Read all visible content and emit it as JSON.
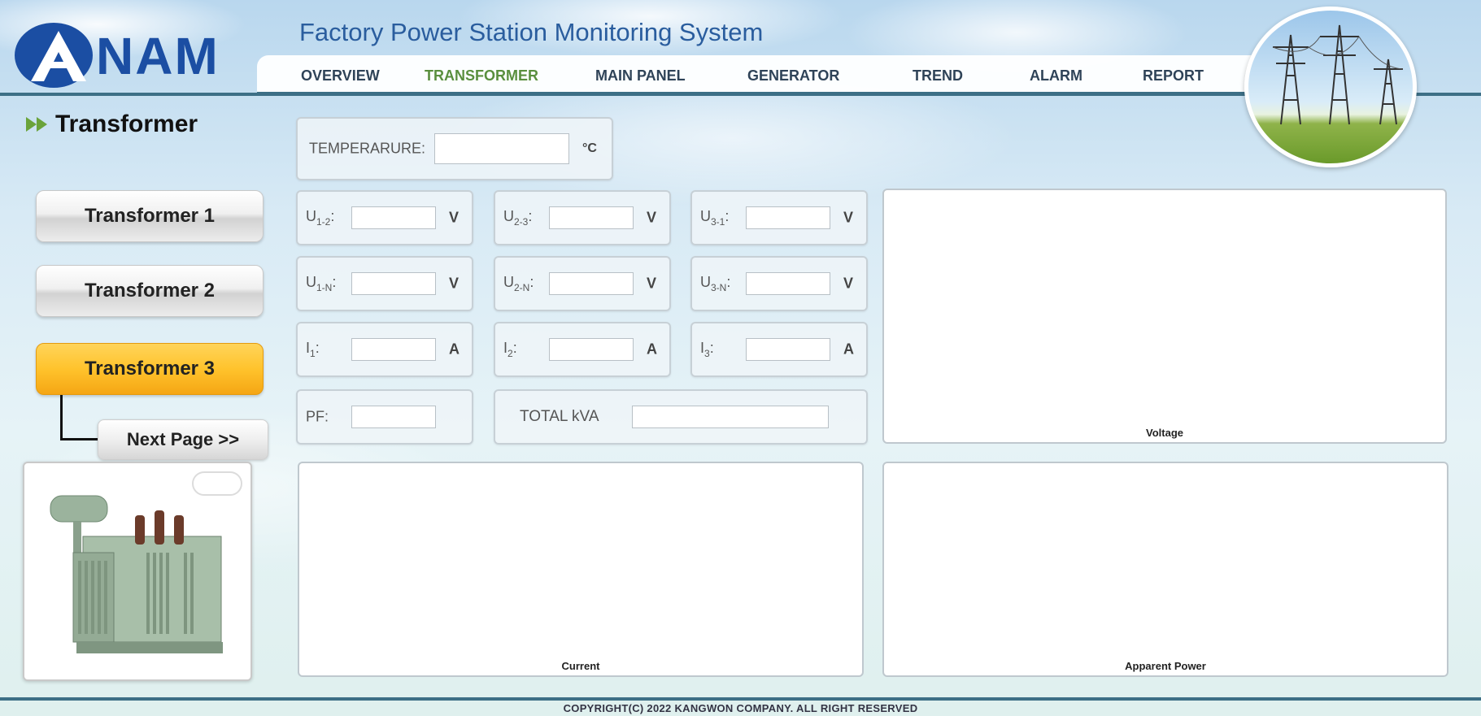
{
  "header": {
    "logo_text": "ANAM",
    "title": "Factory Power Station Monitoring System"
  },
  "nav": {
    "items": [
      {
        "label": "OVERVIEW",
        "active": false
      },
      {
        "label": "TRANSFORMER",
        "active": true
      },
      {
        "label": "MAIN PANEL",
        "active": false
      },
      {
        "label": "GENERATOR",
        "active": false
      },
      {
        "label": "TREND",
        "active": false
      },
      {
        "label": "ALARM",
        "active": false
      },
      {
        "label": "REPORT",
        "active": false
      }
    ]
  },
  "sidebar": {
    "title": "Transformer",
    "buttons": [
      {
        "label": "Transformer 1",
        "active": false
      },
      {
        "label": "Transformer 2",
        "active": false
      },
      {
        "label": "Transformer 3",
        "active": true
      }
    ],
    "next_page": "Next Page >>"
  },
  "readings": {
    "temperature": {
      "label": "TEMPERARURE:",
      "value": "",
      "unit": "°C"
    },
    "u12": {
      "label_main": "U",
      "label_sub": "1-2",
      "suffix": ":",
      "value": "",
      "unit": "V"
    },
    "u23": {
      "label_main": "U",
      "label_sub": "2-3",
      "suffix": ":",
      "value": "",
      "unit": "V"
    },
    "u31": {
      "label_main": "U",
      "label_sub": "3-1",
      "suffix": ":",
      "value": "",
      "unit": "V"
    },
    "u1n": {
      "label_main": "U",
      "label_sub": "1-N",
      "suffix": ":",
      "value": "",
      "unit": "V"
    },
    "u2n": {
      "label_main": "U",
      "label_sub": "2-N",
      "suffix": ":",
      "value": "",
      "unit": "V"
    },
    "u3n": {
      "label_main": "U",
      "label_sub": "3-N",
      "suffix": ":",
      "value": "",
      "unit": "V"
    },
    "i1": {
      "label_main": "I",
      "label_sub": "1",
      "suffix": ":",
      "value": "",
      "unit": "A"
    },
    "i2": {
      "label_main": "I",
      "label_sub": "2",
      "suffix": ":",
      "value": "",
      "unit": "A"
    },
    "i3": {
      "label_main": "I",
      "label_sub": "3",
      "suffix": ":",
      "value": "",
      "unit": "A"
    },
    "pf": {
      "label": "PF:",
      "value": ""
    },
    "total_kva": {
      "label": "TOTAL kVA",
      "value": ""
    }
  },
  "charts": {
    "voltage": "Voltage",
    "current": "Current",
    "apparent_power": "Apparent Power"
  },
  "footer": {
    "copyright": "COPYRIGHT(C) 2022 KANGWON COMPANY. ALL RIGHT RESERVED"
  },
  "colors": {
    "brand_blue": "#1b4ea3",
    "nav_active": "#5a8f3e",
    "active_button": "#ffc32c"
  }
}
